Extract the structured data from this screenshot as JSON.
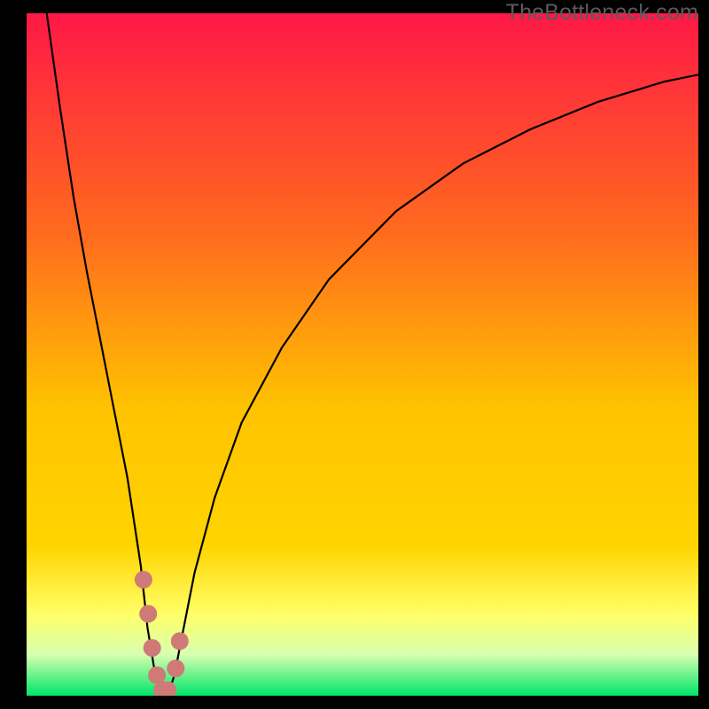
{
  "watermark": "TheBottleneck.com",
  "chart_data": {
    "type": "line",
    "title": "",
    "xlabel": "",
    "ylabel": "",
    "xlim": [
      0,
      100
    ],
    "ylim": [
      0,
      100
    ],
    "grid": false,
    "series": [
      {
        "name": "bottleneck-curve",
        "x": [
          3,
          5,
          7,
          9,
          11,
          13,
          15,
          17,
          18,
          19,
          20,
          21,
          22,
          23,
          25,
          28,
          32,
          38,
          45,
          55,
          65,
          75,
          85,
          95,
          100
        ],
        "y": [
          100,
          86,
          73,
          62,
          52,
          42,
          32,
          19,
          10,
          4,
          0,
          0,
          3,
          8,
          18,
          29,
          40,
          51,
          61,
          71,
          78,
          83,
          87,
          90,
          91
        ]
      }
    ],
    "highlight_points": {
      "name": "segment-markers",
      "color": "#cf7a76",
      "points": [
        {
          "x": 17.4,
          "y": 17
        },
        {
          "x": 18.1,
          "y": 12
        },
        {
          "x": 18.7,
          "y": 7
        },
        {
          "x": 19.4,
          "y": 3
        },
        {
          "x": 20.2,
          "y": 0.8
        },
        {
          "x": 21.0,
          "y": 0.8
        },
        {
          "x": 22.2,
          "y": 4
        },
        {
          "x": 22.8,
          "y": 8
        }
      ]
    },
    "background_gradient": {
      "top": "#ff1846",
      "mid": "#ffd400",
      "low": "#ffff66",
      "pale": "#d7ffb0",
      "bottom": "#00e568"
    }
  }
}
